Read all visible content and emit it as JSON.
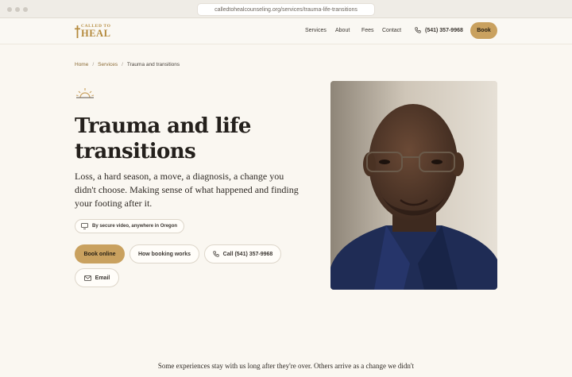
{
  "browser": {
    "url": "calledtohealcounseling.org/services/trauma-life-transitions"
  },
  "site": {
    "logo_top": "CALLED TO",
    "logo_bottom": "HEAL",
    "nav": [
      "Services",
      "About",
      "Fees",
      "Contact"
    ],
    "phone": "(541) 357-9968",
    "book_label": "Book"
  },
  "breadcrumb": {
    "home": "Home",
    "services": "Services",
    "current": "Trauma and transitions",
    "separator": "/"
  },
  "hero": {
    "title": "Trauma and life transitions",
    "intro": "Loss, a hard season, a move, a diagnosis, a change you didn't choose. Making sense of what happened and finding your footing after it.",
    "video_note": "By secure video, anywhere in Oregon",
    "book_online": "Book online",
    "how_booking": "How booking works",
    "call": "Call (541) 357-9968",
    "email": "Email"
  },
  "body": {
    "paragraph": "Some experiences stay with us long after they're over. Others arrive as a change we didn't"
  },
  "icons": [
    "sunrise-icon",
    "monitor-icon",
    "phone-icon",
    "mail-icon",
    "cross-icon"
  ],
  "colors": {
    "accent": "#c9a15f",
    "logo": "#b48a3c",
    "background": "#faf7f1",
    "text": "#24201c"
  }
}
